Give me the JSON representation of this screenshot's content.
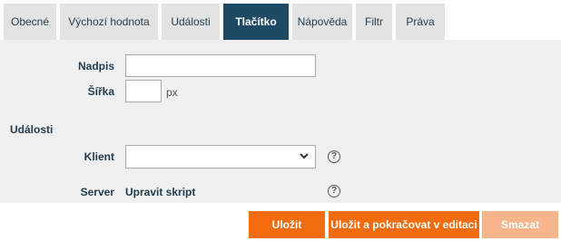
{
  "tabs": [
    {
      "label": "Obecné"
    },
    {
      "label": "Výchozí hodnota"
    },
    {
      "label": "Události"
    },
    {
      "label": "Tlačítko"
    },
    {
      "label": "Nápověda"
    },
    {
      "label": "Filtr"
    },
    {
      "label": "Práva"
    }
  ],
  "active_tab": "Tlačítko",
  "form": {
    "caption_label": "Nadpis",
    "caption_value": "",
    "width_label": "Šířka",
    "width_value": "",
    "width_unit": "px",
    "events_heading": "Události",
    "client_label": "Klient",
    "client_selected": "",
    "server_label": "Server",
    "server_link": "Upravit skript",
    "help_glyph": "?"
  },
  "buttons": {
    "save": "Uložit",
    "save_continue": "Uložit a pokračovat v editaci",
    "delete": "Smazat"
  },
  "colors": {
    "active_tab_bg": "#1f4a66",
    "tab_bg": "#e3e3e3",
    "panel_bg": "#f0f0f0",
    "primary_button": "#f26b0c",
    "disabled_button": "#f8b48a"
  }
}
